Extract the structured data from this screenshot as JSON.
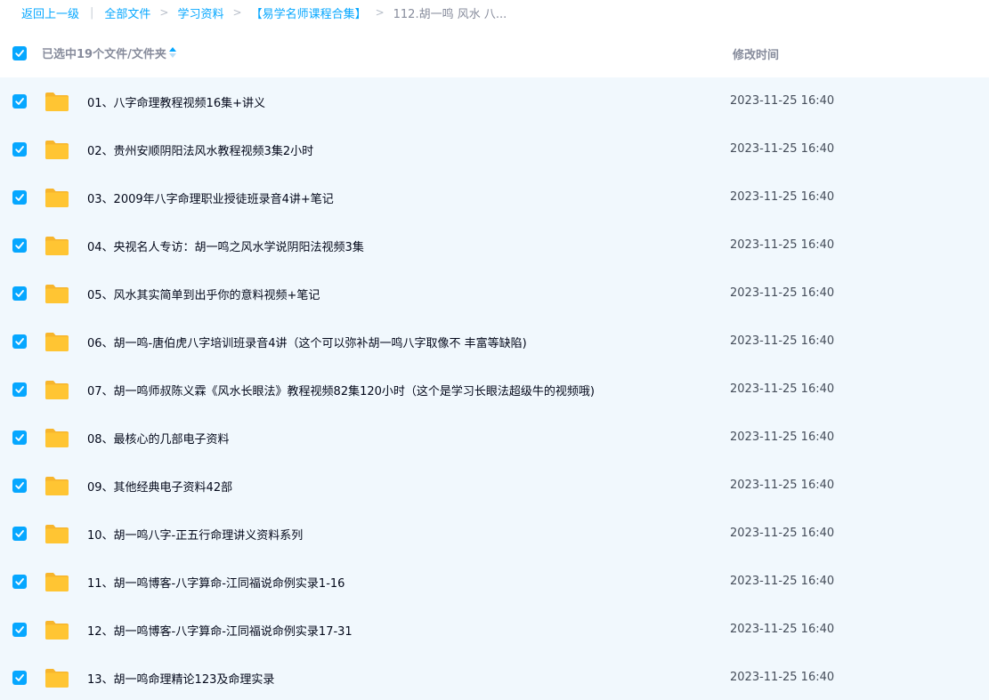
{
  "breadcrumb": {
    "back": "返回上一级",
    "separator": "|",
    "items": [
      "全部文件",
      "学习资料",
      "【易学名师课程合集】"
    ],
    "current": "112.胡一鸣 风水 八..."
  },
  "header": {
    "selected_text": "已选中19个文件/文件夹",
    "time_label": "修改时间"
  },
  "icons": {
    "folder": "folder-icon",
    "checkbox": "checkbox-checked-icon",
    "sort": "sort-icon"
  },
  "colors": {
    "accent": "#06a7ff",
    "row_background": "#f1f8fd",
    "folder": "#ffc533"
  },
  "files": [
    {
      "name": "01、八字命理教程视频16集+讲义",
      "time": "2023-11-25 16:40"
    },
    {
      "name": "02、贵州安顺阴阳法风水教程视频3集2小时",
      "time": "2023-11-25 16:40"
    },
    {
      "name": "03、2009年八字命理职业授徒班录音4讲+笔记",
      "time": "2023-11-25 16:40"
    },
    {
      "name": "04、央视名人专访：胡一鸣之风水学说阴阳法视频3集",
      "time": "2023-11-25 16:40"
    },
    {
      "name": "05、风水其实简单到出乎你的意料视频+笔记",
      "time": "2023-11-25 16:40"
    },
    {
      "name": "06、胡一鸣-唐伯虎八字培训班录音4讲（这个可以弥补胡一鸣八字取像不 丰富等缺陷)",
      "time": "2023-11-25 16:40"
    },
    {
      "name": "07、胡一鸣师叔陈义霖《风水长眼法》教程视频82集120小时（这个是学习长眼法超级牛的视频哦)",
      "time": "2023-11-25 16:40"
    },
    {
      "name": "08、最核心的几部电子资料",
      "time": "2023-11-25 16:40"
    },
    {
      "name": "09、其他经典电子资料42部",
      "time": "2023-11-25 16:40"
    },
    {
      "name": "10、胡一鸣八字-正五行命理讲义资料系列",
      "time": "2023-11-25 16:40"
    },
    {
      "name": "11、胡一鸣博客-八字算命-江同福说命例实录1-16",
      "time": "2023-11-25 16:40"
    },
    {
      "name": "12、胡一鸣博客-八字算命-江同福说命例实录17-31",
      "time": "2023-11-25 16:40"
    },
    {
      "name": "13、胡一鸣命理精论123及命理实录",
      "time": "2023-11-25 16:40"
    }
  ]
}
